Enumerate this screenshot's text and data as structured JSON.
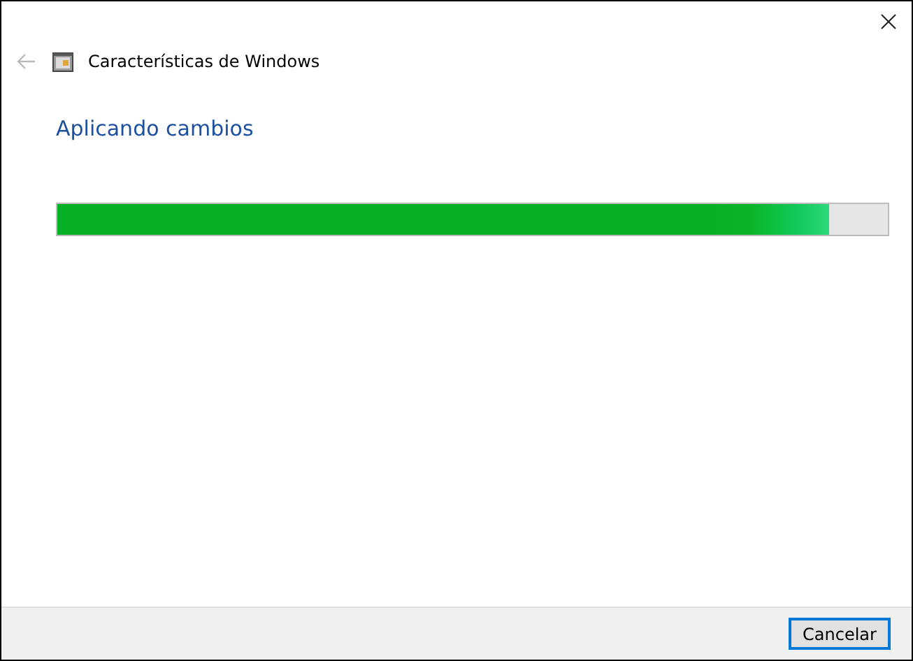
{
  "window": {
    "title": "Características de Windows"
  },
  "heading": "Aplicando cambios",
  "progress": {
    "level": 0.93
  },
  "buttons": [
    {
      "label": "Cancelar",
      "selected": true
    }
  ]
}
